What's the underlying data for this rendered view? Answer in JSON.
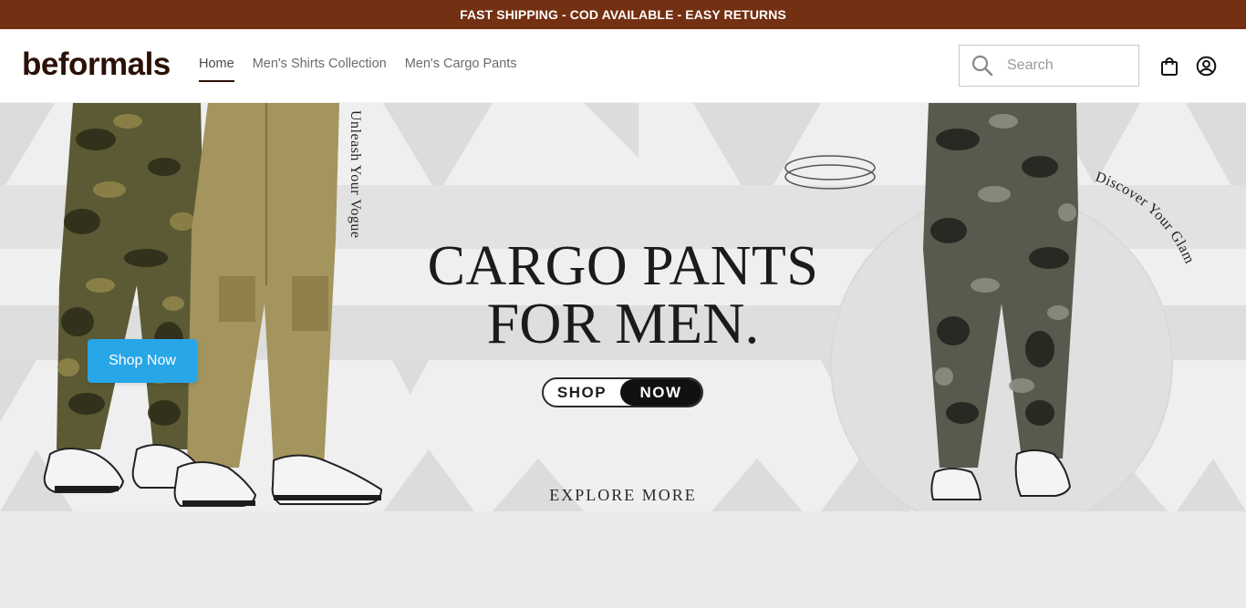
{
  "announcement": {
    "text": "FAST SHIPPING - COD AVAILABLE - EASY RETURNS",
    "bg_color": "#733012"
  },
  "header": {
    "logo": "beformals",
    "nav": [
      {
        "label": "Home",
        "active": true
      },
      {
        "label": "Men's Shirts Collection",
        "active": false
      },
      {
        "label": "Men's Cargo Pants",
        "active": false
      }
    ],
    "search": {
      "placeholder": "Search",
      "value": ""
    },
    "icons": [
      "search-icon",
      "shopping-bag-icon",
      "account-icon"
    ]
  },
  "hero": {
    "title_line1": "CARGO PANTS",
    "title_line2": "FOR MEN.",
    "pill_left": "SHOP",
    "pill_right": "NOW",
    "explore": "EXPLORE MORE",
    "shop_now_button": "Shop Now",
    "vertical_text": "Unleash Your Vogue",
    "curved_text": "Discover Your Glam",
    "accent_color": "#27a6e8"
  }
}
